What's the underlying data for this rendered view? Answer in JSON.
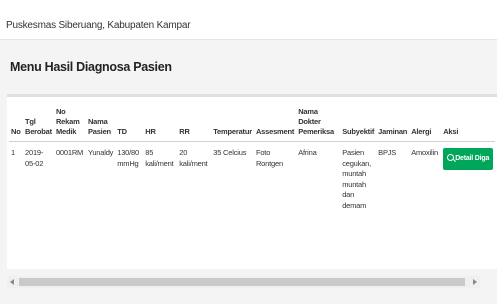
{
  "header": {
    "site_name": "Puskesmas Siberuang, Kabupaten Kampar"
  },
  "page": {
    "title": "Menu Hasil Diagnosa Pasien"
  },
  "table": {
    "columns": [
      "No",
      "Tgl Berobat",
      "No Rekam Medik",
      "Nama Pasien",
      "TD",
      "HR",
      "RR",
      "Temperatur",
      "Assesment",
      "Nama Dokter Pemeriksa",
      "Subyektif",
      "Jaminan",
      "Alergi",
      "Aksi"
    ],
    "rows": [
      {
        "no": "1",
        "tgl_berobat": "2019-05-02",
        "no_rekam_medik": "0001RM",
        "nama_pasien": "Yunaldy",
        "td": "130/80 mmHg",
        "hr": "85 kali/ment",
        "rr": "20 kali/ment",
        "temperatur": "35 Celcius",
        "assesment": "Foto Rontgen",
        "dokter": "Afrina",
        "subyektif": "Pasien cegukan, muntah muntah dan demam",
        "jaminan": "BPJS",
        "alergi": "Amoxilin",
        "aksi_label": "Detail Diga"
      }
    ]
  },
  "colors": {
    "action_button": "#00a65a",
    "background": "#f4f4f4"
  },
  "icons": {
    "detail_button": "search-icon"
  }
}
